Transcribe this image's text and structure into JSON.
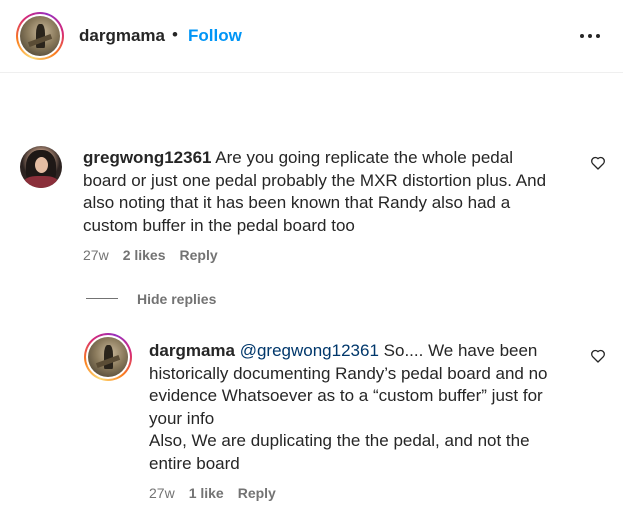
{
  "header": {
    "username": "dargmama",
    "separator": "•",
    "follow_label": "Follow",
    "more_icon": "more-horizontal-icon"
  },
  "comment": {
    "username": "gregwong12361",
    "lines": [
      "Are you going replicate the whole pedal",
      "board or just one pedal probably the MXR distortion plus. And",
      "also noting that it has been known that Randy also had a",
      "custom buffer in the pedal board too"
    ],
    "age": "27w",
    "likes": "2 likes",
    "reply_label": "Reply",
    "like_icon": "heart-icon"
  },
  "hide_replies_label": "Hide replies",
  "reply": {
    "username": "dargmama",
    "mention": "@gregwong12361",
    "first_line_rest": "So.... We have been",
    "lines": [
      "historically documenting Randy’s pedal board and no",
      "evidence Whatsoever as to a “custom buffer” just for",
      "your info",
      "Also, We are duplicating the the pedal, and not the",
      "entire board"
    ],
    "age": "27w",
    "likes": "1 like",
    "reply_label": "Reply",
    "like_icon": "heart-icon"
  }
}
